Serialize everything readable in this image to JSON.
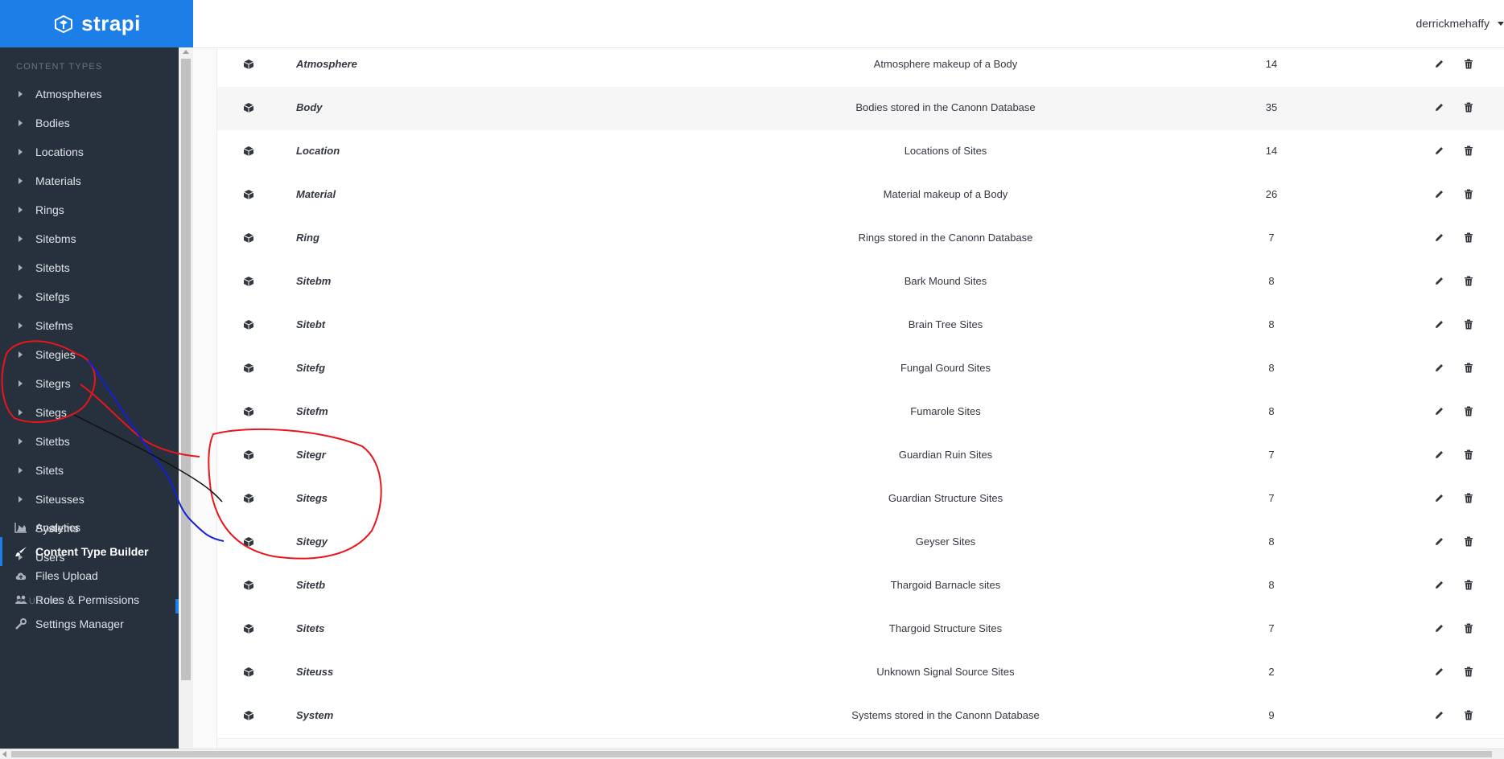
{
  "brand": {
    "name": "strapi",
    "color": "#1c7fe8",
    "icon": "strapi-logo-icon"
  },
  "header": {
    "user": "derrickmehaffy"
  },
  "sidebar": {
    "content_types_title": "CONTENT TYPES",
    "content_types": [
      {
        "label": "Atmospheres"
      },
      {
        "label": "Bodies"
      },
      {
        "label": "Locations"
      },
      {
        "label": "Materials"
      },
      {
        "label": "Rings"
      },
      {
        "label": "Sitebms"
      },
      {
        "label": "Sitebts"
      },
      {
        "label": "Sitefgs"
      },
      {
        "label": "Sitefms"
      },
      {
        "label": "Sitegies"
      },
      {
        "label": "Sitegrs"
      },
      {
        "label": "Sitegs"
      },
      {
        "label": "Sitetbs"
      },
      {
        "label": "Sitets"
      },
      {
        "label": "Siteusses"
      },
      {
        "label": "Systems"
      },
      {
        "label": "Users"
      }
    ],
    "plugins_title": "PLUGINS",
    "plugins": [
      {
        "label": "Analytics",
        "icon": "chart-area-icon"
      },
      {
        "label": "Content Type Builder",
        "icon": "paint-brush-icon",
        "active": true
      },
      {
        "label": "Files Upload",
        "icon": "cloud-upload-icon"
      },
      {
        "label": "Roles & Permissions",
        "icon": "users-icon"
      },
      {
        "label": "Settings Manager",
        "icon": "wrench-icon"
      }
    ]
  },
  "table": {
    "rows": [
      {
        "name": "Atmosphere",
        "description": "Atmosphere makeup of a Body",
        "count": "14"
      },
      {
        "name": "Body",
        "description": "Bodies stored in the Canonn Database",
        "count": "35"
      },
      {
        "name": "Location",
        "description": "Locations of Sites",
        "count": "14"
      },
      {
        "name": "Material",
        "description": "Material makeup of a Body",
        "count": "26"
      },
      {
        "name": "Ring",
        "description": "Rings stored in the Canonn Database",
        "count": "7"
      },
      {
        "name": "Sitebm",
        "description": "Bark Mound Sites",
        "count": "8"
      },
      {
        "name": "Sitebt",
        "description": "Brain Tree Sites",
        "count": "8"
      },
      {
        "name": "Sitefg",
        "description": "Fungal Gourd Sites",
        "count": "8"
      },
      {
        "name": "Sitefm",
        "description": "Fumarole Sites",
        "count": "8"
      },
      {
        "name": "Sitegr",
        "description": "Guardian Ruin Sites",
        "count": "7"
      },
      {
        "name": "Sitegs",
        "description": "Guardian Structure Sites",
        "count": "7"
      },
      {
        "name": "Sitegy",
        "description": "Geyser Sites",
        "count": "8"
      },
      {
        "name": "Sitetb",
        "description": "Thargoid Barnacle sites",
        "count": "8"
      },
      {
        "name": "Sitets",
        "description": "Thargoid Structure Sites",
        "count": "7"
      },
      {
        "name": "Siteuss",
        "description": "Unknown Signal Source Sites",
        "count": "2"
      },
      {
        "name": "System",
        "description": "Systems stored in the Canonn Database",
        "count": "9"
      }
    ]
  },
  "annotation_colors": {
    "red": "#e8161c",
    "blue": "#1420d8",
    "black": "#111111"
  }
}
